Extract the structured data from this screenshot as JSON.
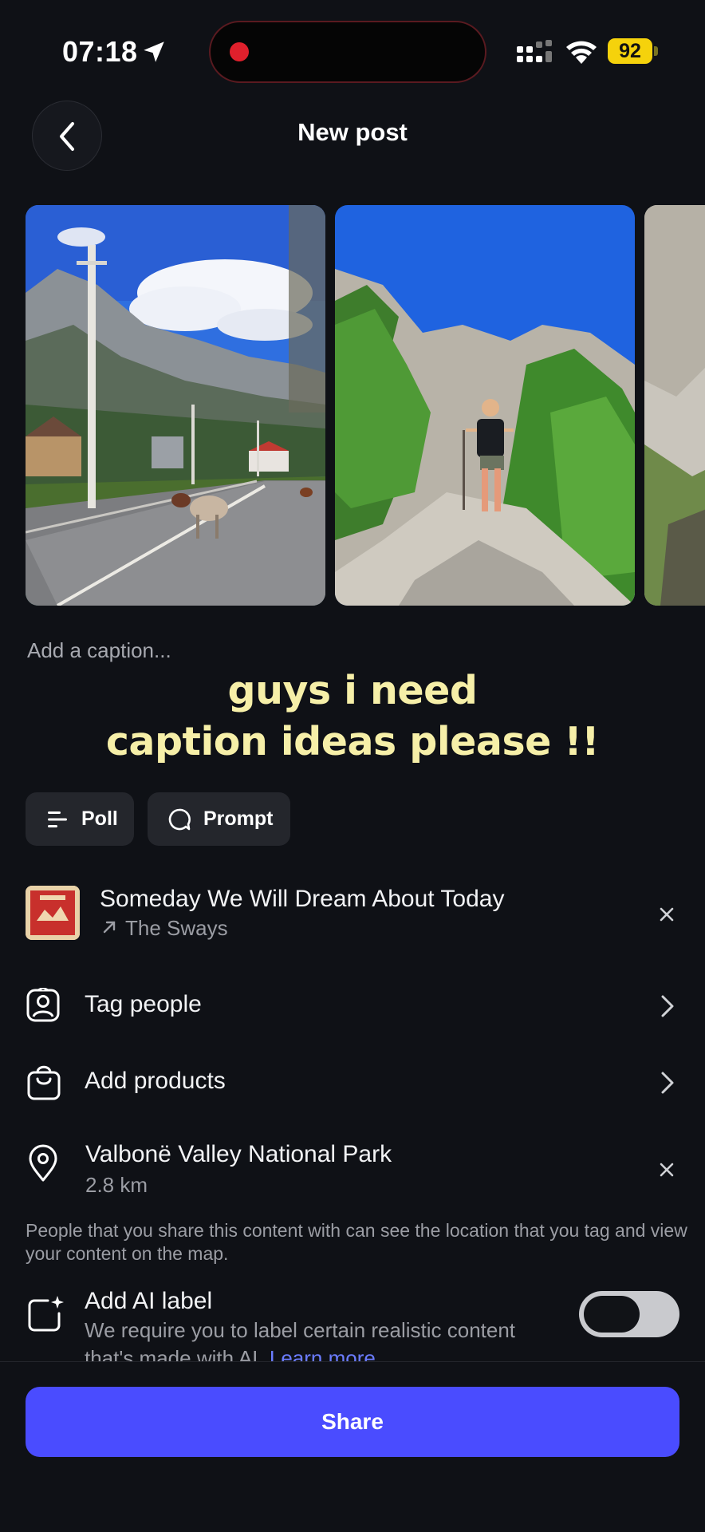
{
  "status_bar": {
    "time": "07:18",
    "battery": "92"
  },
  "header": {
    "title": "New post"
  },
  "caption": {
    "placeholder": "Add a caption...",
    "overlay_line1": "guys i need",
    "overlay_line2": "caption ideas please !!"
  },
  "chips": {
    "poll": "Poll",
    "prompt": "Prompt"
  },
  "music": {
    "title": "Someday We Will Dream About Today",
    "artist": "The Sways"
  },
  "rows": {
    "tag_people": "Tag people",
    "add_products": "Add products",
    "location_name": "Valbonë Valley National Park",
    "location_distance": "2.8 km"
  },
  "location_note": "People that you share this content with can see the location that you tag and view your content on the map.",
  "ai_label": {
    "title": "Add AI label",
    "description": "We require you to label certain realistic content that's made with AI.",
    "learn_more": "Learn more",
    "enabled": false
  },
  "share_button": "Share",
  "colors": {
    "accent": "#4a4cff",
    "overlay_text": "#f6efa8",
    "background": "#0f1116",
    "link": "#6b7cff"
  }
}
